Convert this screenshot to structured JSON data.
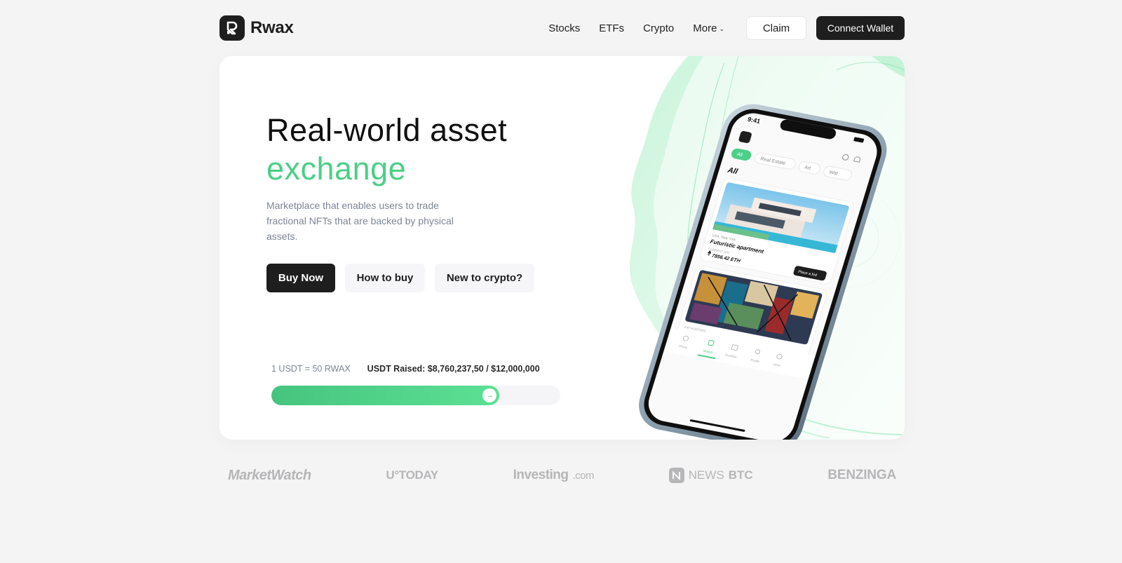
{
  "brand": {
    "name": "Rwax",
    "logo_icon": "rwax-logo-icon"
  },
  "nav": {
    "links": [
      "Stocks",
      "ETFs",
      "Crypto"
    ],
    "more_label": "More",
    "claim_label": "Claim",
    "connect_label": "Connect Wallet"
  },
  "hero": {
    "title_line1": "Real-world asset",
    "title_line2": "exchange",
    "description": "Marketplace that enables users to trade fractional NFTs that are backed by physical assets.",
    "buttons": {
      "buy_now": "Buy Now",
      "how_to_buy": "How to buy",
      "new_to_crypto": "New to crypto?"
    },
    "rate": "1 USDT = 50 RWAX",
    "raised": "USDT Raised: $8,760,237,50 / $12,000,000",
    "progress_fraction": 0.79
  },
  "phone": {
    "time": "9:41",
    "filters": [
      "All",
      "Real Estate",
      "Art",
      "Wat"
    ],
    "section_title": "All",
    "listing1": {
      "location": "USA, New York",
      "name": "Futuristic apartment",
      "bid_label": "CURRENT BID",
      "price": "7856.42 ETH",
      "bid_button": "Place a bid"
    },
    "listing2_label": "ART POSTERS",
    "tabs": [
      "Home",
      "Market",
      "Portfolio",
      "Profile",
      "More"
    ]
  },
  "press": [
    "MarketWatch",
    "U°TODAY",
    "Investing",
    ".com",
    "NEWS",
    "BTC",
    "BENZINGA"
  ],
  "colors": {
    "accent": "#4ccf87",
    "dark": "#1e1e1e",
    "page_bg": "#f4f4f4"
  }
}
